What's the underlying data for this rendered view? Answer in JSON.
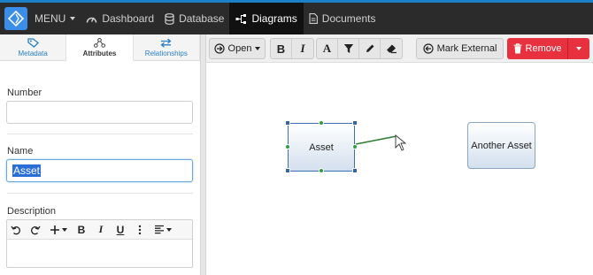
{
  "nav": {
    "menu_label": "MENU",
    "items": [
      {
        "label": "Dashboard",
        "icon": "gauge-icon"
      },
      {
        "label": "Database",
        "icon": "database-icon"
      },
      {
        "label": "Diagrams",
        "icon": "diagram-icon",
        "active": true
      },
      {
        "label": "Documents",
        "icon": "document-icon"
      }
    ]
  },
  "left": {
    "tabs": [
      {
        "label": "Metadata",
        "icon": "tag-icon"
      },
      {
        "label": "Attributes",
        "icon": "sitemap-icon",
        "active": true
      },
      {
        "label": "Relationships",
        "icon": "exchange-icon"
      }
    ],
    "fields": {
      "number": {
        "label": "Number",
        "value": ""
      },
      "name": {
        "label": "Name",
        "value": "Asset"
      },
      "description": {
        "label": "Description",
        "value": ""
      }
    },
    "editor_toolbar": [
      "undo-icon",
      "redo-icon",
      "insert-plus-icon",
      "bold-icon",
      "italic-icon",
      "underline-icon",
      "more-vertical-icon",
      "align-left-icon"
    ],
    "editor_labels": {
      "bold": "B",
      "italic": "I",
      "underline": "U"
    }
  },
  "toolbar": {
    "open_label": "Open",
    "bold": "B",
    "italic": "I",
    "font": "A",
    "mark_external_label": "Mark External",
    "remove_label": "Remove"
  },
  "diagram": {
    "nodes": [
      {
        "label": "Asset",
        "selected": true
      },
      {
        "label": "Another Asset",
        "selected": false
      }
    ]
  },
  "colors": {
    "accent": "#1a80c8",
    "remove": "#e8313f",
    "selection": "#3366aa",
    "connector": "#2e9e40"
  }
}
